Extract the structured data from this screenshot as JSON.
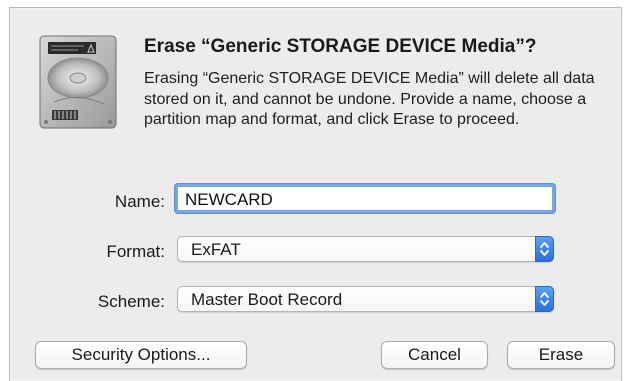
{
  "dialog": {
    "title": "Erase “Generic STORAGE DEVICE Media”?",
    "message": "Erasing “Generic STORAGE DEVICE Media” will delete all data stored on it, and cannot be undone. Provide a name, choose a partition map and format, and click Erase to proceed.",
    "icon": "external-disk-icon"
  },
  "form": {
    "name_label": "Name:",
    "name_value": "NEWCARD",
    "format_label": "Format:",
    "format_value": "ExFAT",
    "scheme_label": "Scheme:",
    "scheme_value": "Master Boot Record"
  },
  "buttons": {
    "security_options": "Security Options...",
    "cancel": "Cancel",
    "erase": "Erase"
  },
  "colors": {
    "dialog_background": "#ececec",
    "focus_ring": "#7aa7e0",
    "popup_accent": "#3b82f0"
  }
}
